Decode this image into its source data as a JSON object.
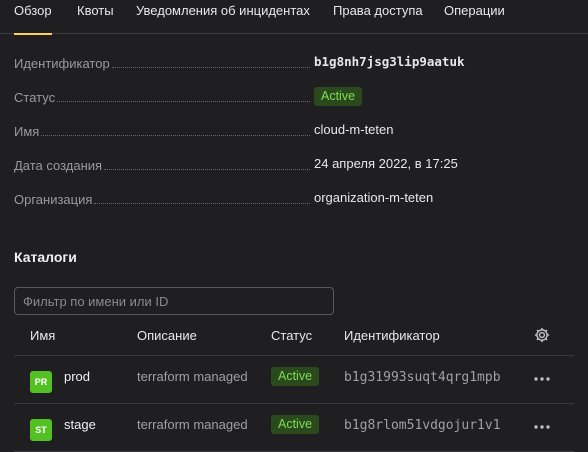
{
  "tabs": [
    {
      "label": "Обзор"
    },
    {
      "label": "Квоты"
    },
    {
      "label": "Уведомления об инцидентах"
    },
    {
      "label": "Права доступа"
    },
    {
      "label": "Операции"
    }
  ],
  "properties": {
    "id_label": "Идентификатор",
    "id_value": "b1g8nh7jsg3lip9aatuk",
    "status_label": "Статус",
    "status_value": "Active",
    "name_label": "Имя",
    "name_value": "cloud-m-teten",
    "created_label": "Дата создания",
    "created_value": "24 апреля 2022, в 17:25",
    "org_label": "Организация",
    "org_value": "organization-m-teten"
  },
  "catalogs": {
    "title": "Каталоги",
    "filter_placeholder": "Фильтр по имени или ID",
    "columns": {
      "name": "Имя",
      "description": "Описание",
      "status": "Статус",
      "id": "Идентификатор"
    },
    "rows": [
      {
        "avatar": "PR",
        "name": "prod",
        "description": "terraform managed",
        "status": "Active",
        "id": "b1g31993suqt4qrg1mpb"
      },
      {
        "avatar": "ST",
        "name": "stage",
        "description": "terraform managed",
        "status": "Active",
        "id": "b1g8rlom51vdgojur1v1"
      }
    ]
  },
  "colors": {
    "background": "#1f1f21",
    "active_tab_underline": "#ffd24d",
    "status_active_bg": "#2a4a1e",
    "status_active_text": "#7ddc52",
    "avatar_bg": "#54c023"
  },
  "icons": {
    "settings": "gear-icon",
    "row_menu": "more-horizontal-icon"
  }
}
